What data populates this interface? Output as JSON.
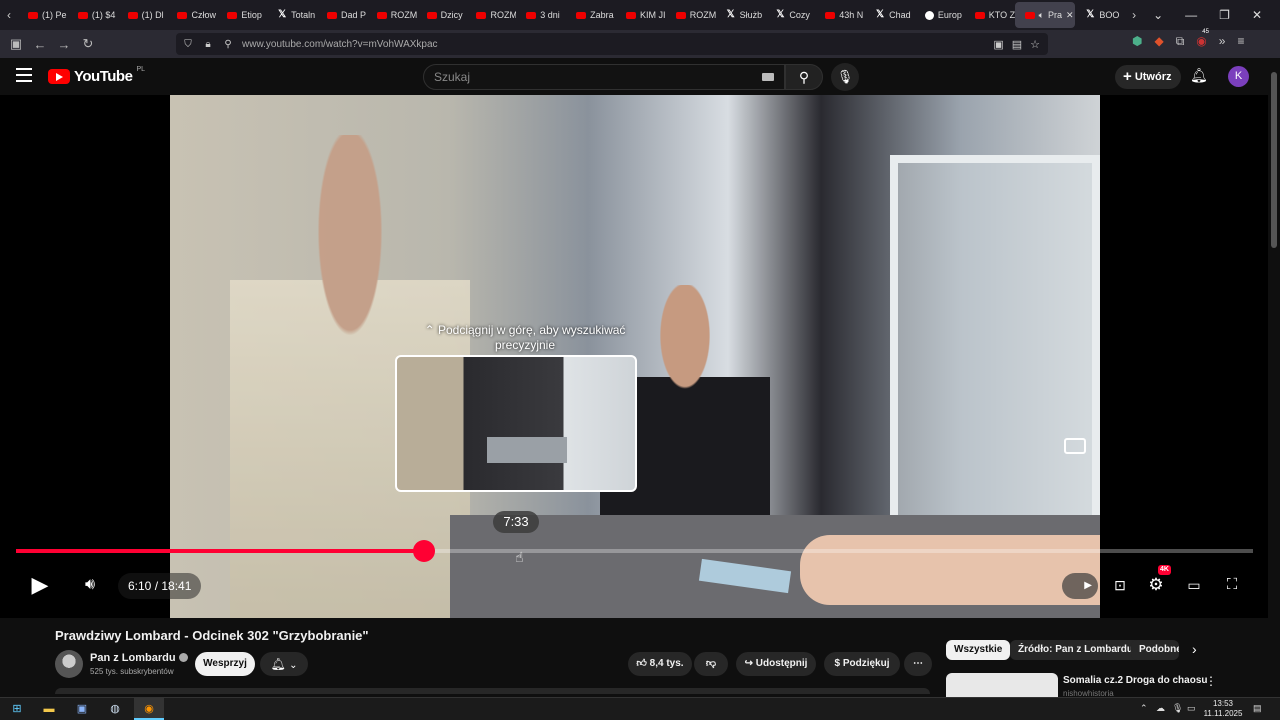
{
  "browser": {
    "tabs": [
      {
        "label": "(1) Pe",
        "icon": "youtube"
      },
      {
        "label": "(1) $4",
        "icon": "youtube"
      },
      {
        "label": "(1) Dl",
        "icon": "youtube"
      },
      {
        "label": "Człow",
        "icon": "youtube"
      },
      {
        "label": "Etiop",
        "icon": "youtube"
      },
      {
        "label": "Totaln",
        "icon": "x"
      },
      {
        "label": "Dad P",
        "icon": "youtube"
      },
      {
        "label": "ROZM",
        "icon": "youtube"
      },
      {
        "label": "Dzicy",
        "icon": "youtube"
      },
      {
        "label": "ROZM",
        "icon": "youtube"
      },
      {
        "label": "3 dni",
        "icon": "youtube"
      },
      {
        "label": "Zabra",
        "icon": "youtube"
      },
      {
        "label": "KIM JI",
        "icon": "youtube"
      },
      {
        "label": "ROZM",
        "icon": "youtube"
      },
      {
        "label": "Służb",
        "icon": "x"
      },
      {
        "label": "Cozy",
        "icon": "x"
      },
      {
        "label": "43h N",
        "icon": "youtube"
      },
      {
        "label": "Chad",
        "icon": "x"
      },
      {
        "label": "Europ",
        "icon": "globe"
      },
      {
        "label": "KTO Z",
        "icon": "youtube"
      },
      {
        "label": "Pra",
        "icon": "youtube",
        "active": true
      },
      {
        "label": "BOO",
        "icon": "x"
      }
    ],
    "url": "www.youtube.com/watch?v=mVohWAXkpac",
    "ext_badge": "45"
  },
  "header": {
    "logo_text": "YouTube",
    "region": "PL",
    "search_placeholder": "Szukaj",
    "create_label": "Utwórz",
    "avatar_letter": "K"
  },
  "player": {
    "hint": "Podciągnij w górę, aby wyszukiwać precyzyjnie",
    "hover_time": "7:33",
    "current_time": "6:10",
    "duration": "18:41",
    "progress_fraction": 0.33,
    "quality_badge": "4K",
    "progress_color": "#ff0033"
  },
  "video_info": {
    "title": "Prawdziwy Lombard - Odcinek 302 \"Grzybobranie\"",
    "channel": "Pan z Lombardu",
    "subscribers": "525 tys. subskrybentów",
    "support_label": "Wesprzyj",
    "likes": "8,4 tys.",
    "share_label": "Udostępnij",
    "thanks_label": "Podziękuj"
  },
  "sidebar": {
    "chips": [
      "Wszystkie",
      "Źródło: Pan z Lombardu",
      "Podobne"
    ],
    "recommendation": {
      "title": "Somalia cz.2 Droga do chaosu",
      "channel": "nishowhistoria"
    }
  },
  "taskbar": {
    "time": "13:53",
    "date": "11.11.2025"
  }
}
